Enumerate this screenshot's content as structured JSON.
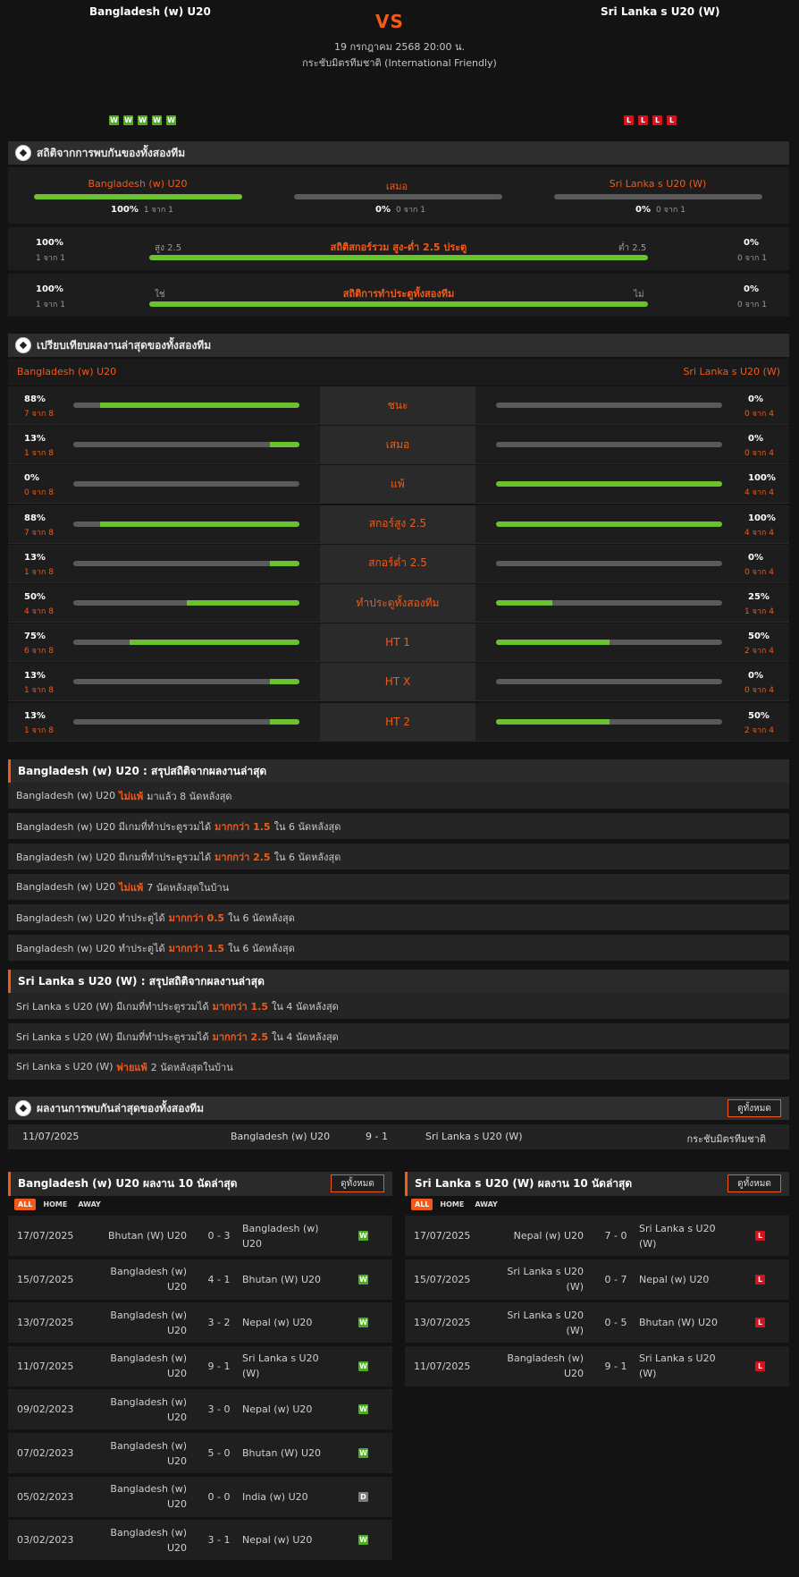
{
  "header": {
    "home": "Bangladesh (w) U20",
    "away": "Sri Lanka s U20 (W)",
    "vs": "VS",
    "datetime": "19 กรกฎาคม 2568 20:00 น.",
    "competition": "กระชับมิตรทีมชาติ (International Friendly)",
    "home_form": [
      "W",
      "W",
      "W",
      "W",
      "W"
    ],
    "away_form": [
      "L",
      "L",
      "L",
      "L"
    ]
  },
  "h2h": {
    "title": "สถิติจากการพบกันของทั้งสองทีม",
    "home": {
      "name": "Bangladesh (w) U20",
      "pct": "100%",
      "sub": "1 จาก 1",
      "fill": 1.0
    },
    "draw": {
      "name": "เสมอ",
      "pct": "0%",
      "sub": "0 จาก 1",
      "fill": 0
    },
    "away": {
      "name": "Sri Lanka s U20 (W)",
      "pct": "0%",
      "sub": "0 จาก 1",
      "fill": 0
    },
    "ou": {
      "title": "สถิติสกอร์รวม สูง-ต่ำ 2.5 ประตู",
      "left": "สูง 2.5",
      "right": "ต่ำ 2.5",
      "lpct": "100%",
      "lsub": "1 จาก 1",
      "rpct": "0%",
      "rsub": "0 จาก 1",
      "fill": 1.0
    },
    "btts": {
      "title": "สถิติการทำประตูทั้งสองทีม",
      "left": "ใช่",
      "right": "ไม่",
      "lpct": "100%",
      "lsub": "1 จาก 1",
      "rpct": "0%",
      "rsub": "0 จาก 1",
      "fill": 1.0
    }
  },
  "compare": {
    "title": "เปรียบเทียบผลงานล่าสุดของทั้งสองทีม",
    "home": "Bangladesh (w) U20",
    "away": "Sri Lanka s U20 (W)",
    "rows": [
      {
        "label": "ชนะ",
        "hp": "88%",
        "hs": "7 จาก 8",
        "hf": 0.88,
        "ap": "0%",
        "as": "0 จาก 4",
        "af": 0
      },
      {
        "label": "เสมอ",
        "hp": "13%",
        "hs": "1 จาก 8",
        "hf": 0.13,
        "ap": "0%",
        "as": "0 จาก 4",
        "af": 0
      },
      {
        "label": "แพ้",
        "hp": "0%",
        "hs": "0 จาก 8",
        "hf": 0,
        "ap": "100%",
        "as": "4 จาก 4",
        "af": 1.0
      },
      {
        "label": "สกอร์สูง 2.5",
        "hp": "88%",
        "hs": "7 จาก 8",
        "hf": 0.88,
        "ap": "100%",
        "as": "4 จาก 4",
        "af": 1.0
      },
      {
        "label": "สกอร์ต่ำ 2.5",
        "hp": "13%",
        "hs": "1 จาก 8",
        "hf": 0.13,
        "ap": "0%",
        "as": "0 จาก 4",
        "af": 0
      },
      {
        "label": "ทำประตูทั้งสองทีม",
        "hp": "50%",
        "hs": "4 จาก 8",
        "hf": 0.5,
        "ap": "25%",
        "as": "1 จาก 4",
        "af": 0.25
      },
      {
        "label": "HT 1",
        "hp": "75%",
        "hs": "6 จาก 8",
        "hf": 0.75,
        "ap": "50%",
        "as": "2 จาก 4",
        "af": 0.5
      },
      {
        "label": "HT X",
        "hp": "13%",
        "hs": "1 จาก 8",
        "hf": 0.13,
        "ap": "0%",
        "as": "0 จาก 4",
        "af": 0
      },
      {
        "label": "HT 2",
        "hp": "13%",
        "hs": "1 จาก 8",
        "hf": 0.13,
        "ap": "50%",
        "as": "2 จาก 4",
        "af": 0.5
      }
    ]
  },
  "home_summary": {
    "title": "Bangladesh (w) U20 : สรุปสถิติจากผลงานล่าสุด",
    "rows": [
      [
        "Bangladesh (w) U20",
        "ไม่แพ้",
        "มาแล้ว 8 นัดหลังสุด"
      ],
      [
        "Bangladesh (w) U20  มีเกมที่ทำประตูรวมได้",
        "มากกว่า  1.5",
        "ใน 6 นัดหลังสุด"
      ],
      [
        "Bangladesh (w) U20  มีเกมที่ทำประตูรวมได้",
        "มากกว่า  2.5",
        "ใน 6 นัดหลังสุด"
      ],
      [
        "Bangladesh (w) U20",
        "ไม่แพ้",
        "7  นัดหลังสุดในบ้าน"
      ],
      [
        "Bangladesh (w) U20  ทำประตูได้",
        "มากกว่า  0.5",
        "ใน 6 นัดหลังสุด"
      ],
      [
        "Bangladesh (w) U20  ทำประตูได้",
        "มากกว่า  1.5",
        "ใน 6 นัดหลังสุด"
      ]
    ]
  },
  "away_summary": {
    "title": "Sri Lanka s U20 (W) : สรุปสถิติจากผลงานล่าสุด",
    "rows": [
      [
        "Sri Lanka s U20 (W)  มีเกมที่ทำประตูรวมได้",
        "มากกว่า  1.5",
        "ใน 4 นัดหลังสุด"
      ],
      [
        "Sri Lanka s U20 (W)  มีเกมที่ทำประตูรวมได้",
        "มากกว่า  2.5",
        "ใน 4 นัดหลังสุด"
      ],
      [
        "Sri Lanka s U20 (W)",
        "พ่ายแพ้",
        "2  นัดหลังสุดในบ้าน"
      ]
    ]
  },
  "h2h_results": {
    "title": "ผลงานการพบกันล่าสุดของทั้งสองทีม",
    "view_all": "ดูทั้งหมด",
    "rows": [
      {
        "date": "11/07/2025",
        "home": "Bangladesh (w) U20",
        "score": "9 - 1",
        "away": "Sri Lanka s U20 (W)",
        "comp": "กระชับมิตรทีมชาติ"
      }
    ]
  },
  "home_last10": {
    "title": "Bangladesh (w) U20 ผลงาน 10 นัดล่าสุด",
    "view_all": "ดูทั้งหมด",
    "tabs": [
      "ALL",
      "HOME",
      "AWAY"
    ],
    "rows": [
      {
        "date": "17/07/2025",
        "home": "Bhutan (W) U20",
        "score": "0 - 3",
        "away": "Bangladesh (w) U20",
        "res": "W"
      },
      {
        "date": "15/07/2025",
        "home": "Bangladesh (w) U20",
        "score": "4 - 1",
        "away": "Bhutan (W) U20",
        "res": "W"
      },
      {
        "date": "13/07/2025",
        "home": "Bangladesh (w) U20",
        "score": "3 - 2",
        "away": "Nepal (w) U20",
        "res": "W"
      },
      {
        "date": "11/07/2025",
        "home": "Bangladesh (w) U20",
        "score": "9 - 1",
        "away": "Sri Lanka s U20 (W)",
        "res": "W"
      },
      {
        "date": "09/02/2023",
        "home": "Bangladesh (w) U20",
        "score": "3 - 0",
        "away": "Nepal (w) U20",
        "res": "W"
      },
      {
        "date": "07/02/2023",
        "home": "Bangladesh (w) U20",
        "score": "5 - 0",
        "away": "Bhutan (W) U20",
        "res": "W"
      },
      {
        "date": "05/02/2023",
        "home": "Bangladesh (w) U20",
        "score": "0 - 0",
        "away": "India (w) U20",
        "res": "D"
      },
      {
        "date": "03/02/2023",
        "home": "Bangladesh (w) U20",
        "score": "3 - 1",
        "away": "Nepal (w) U20",
        "res": "W"
      }
    ]
  },
  "away_last10": {
    "title": "Sri Lanka s U20 (W) ผลงาน 10 นัดล่าสุด",
    "view_all": "ดูทั้งหมด",
    "tabs": [
      "ALL",
      "HOME",
      "AWAY"
    ],
    "rows": [
      {
        "date": "17/07/2025",
        "home": "Nepal (w) U20",
        "score": "7 - 0",
        "away": "Sri Lanka s U20 (W)",
        "res": "L"
      },
      {
        "date": "15/07/2025",
        "home": "Sri Lanka s U20 (W)",
        "score": "0 - 7",
        "away": "Nepal (w) U20",
        "res": "L"
      },
      {
        "date": "13/07/2025",
        "home": "Sri Lanka s U20 (W)",
        "score": "0 - 5",
        "away": "Bhutan (W) U20",
        "res": "L"
      },
      {
        "date": "11/07/2025",
        "home": "Bangladesh (w) U20",
        "score": "9 - 1",
        "away": "Sri Lanka s U20 (W)",
        "res": "L"
      }
    ]
  },
  "colors": {
    "accent": "#f25a1a",
    "win": "#4cae1f",
    "loss": "#d6121a",
    "draw": "#7c7c7c",
    "bar_fill": "#6cc12f",
    "bar_track": "#5a5a5a"
  }
}
